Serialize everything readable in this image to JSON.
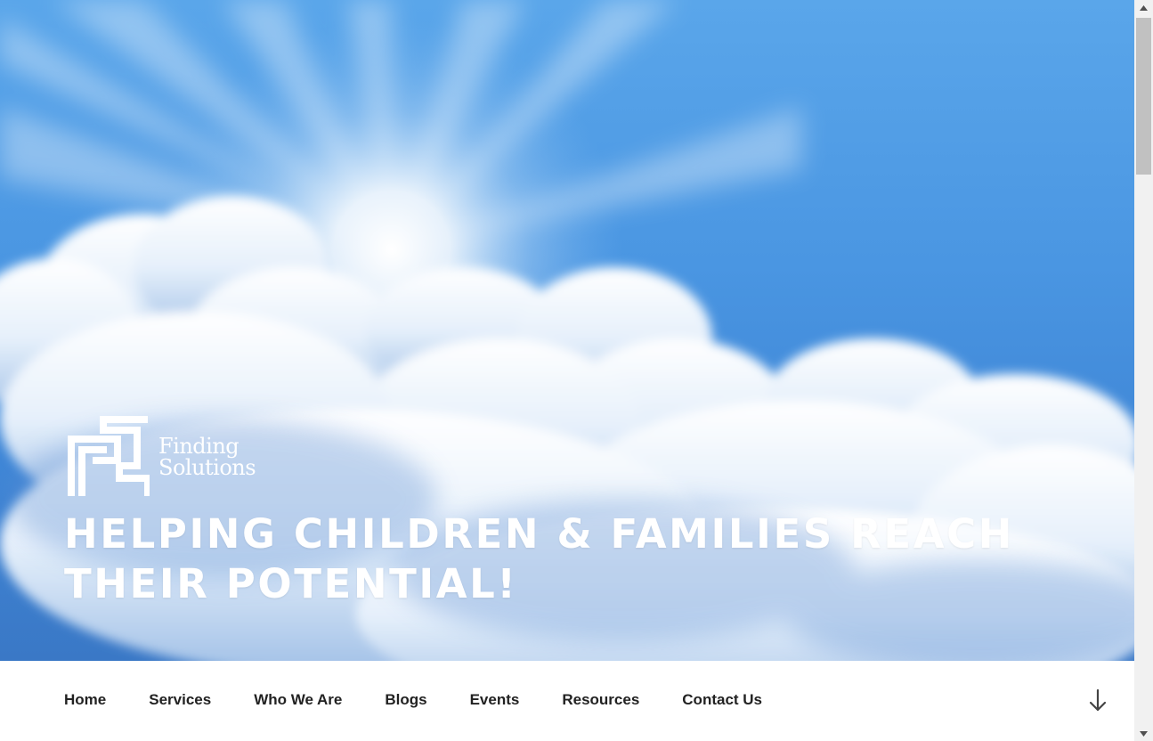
{
  "site": {
    "logo_line1": "Finding",
    "logo_line2": "Solutions",
    "tagline": "Helping Children & Families Reach Their Potential!"
  },
  "nav": {
    "items": [
      "Home",
      "Services",
      "Who We Are",
      "Blogs",
      "Events",
      "Resources",
      "Contact Us"
    ],
    "scroll_icon": "arrow-down-icon"
  },
  "colors": {
    "sky": "#4a96e2",
    "text_dark": "#222222",
    "white": "#ffffff"
  }
}
